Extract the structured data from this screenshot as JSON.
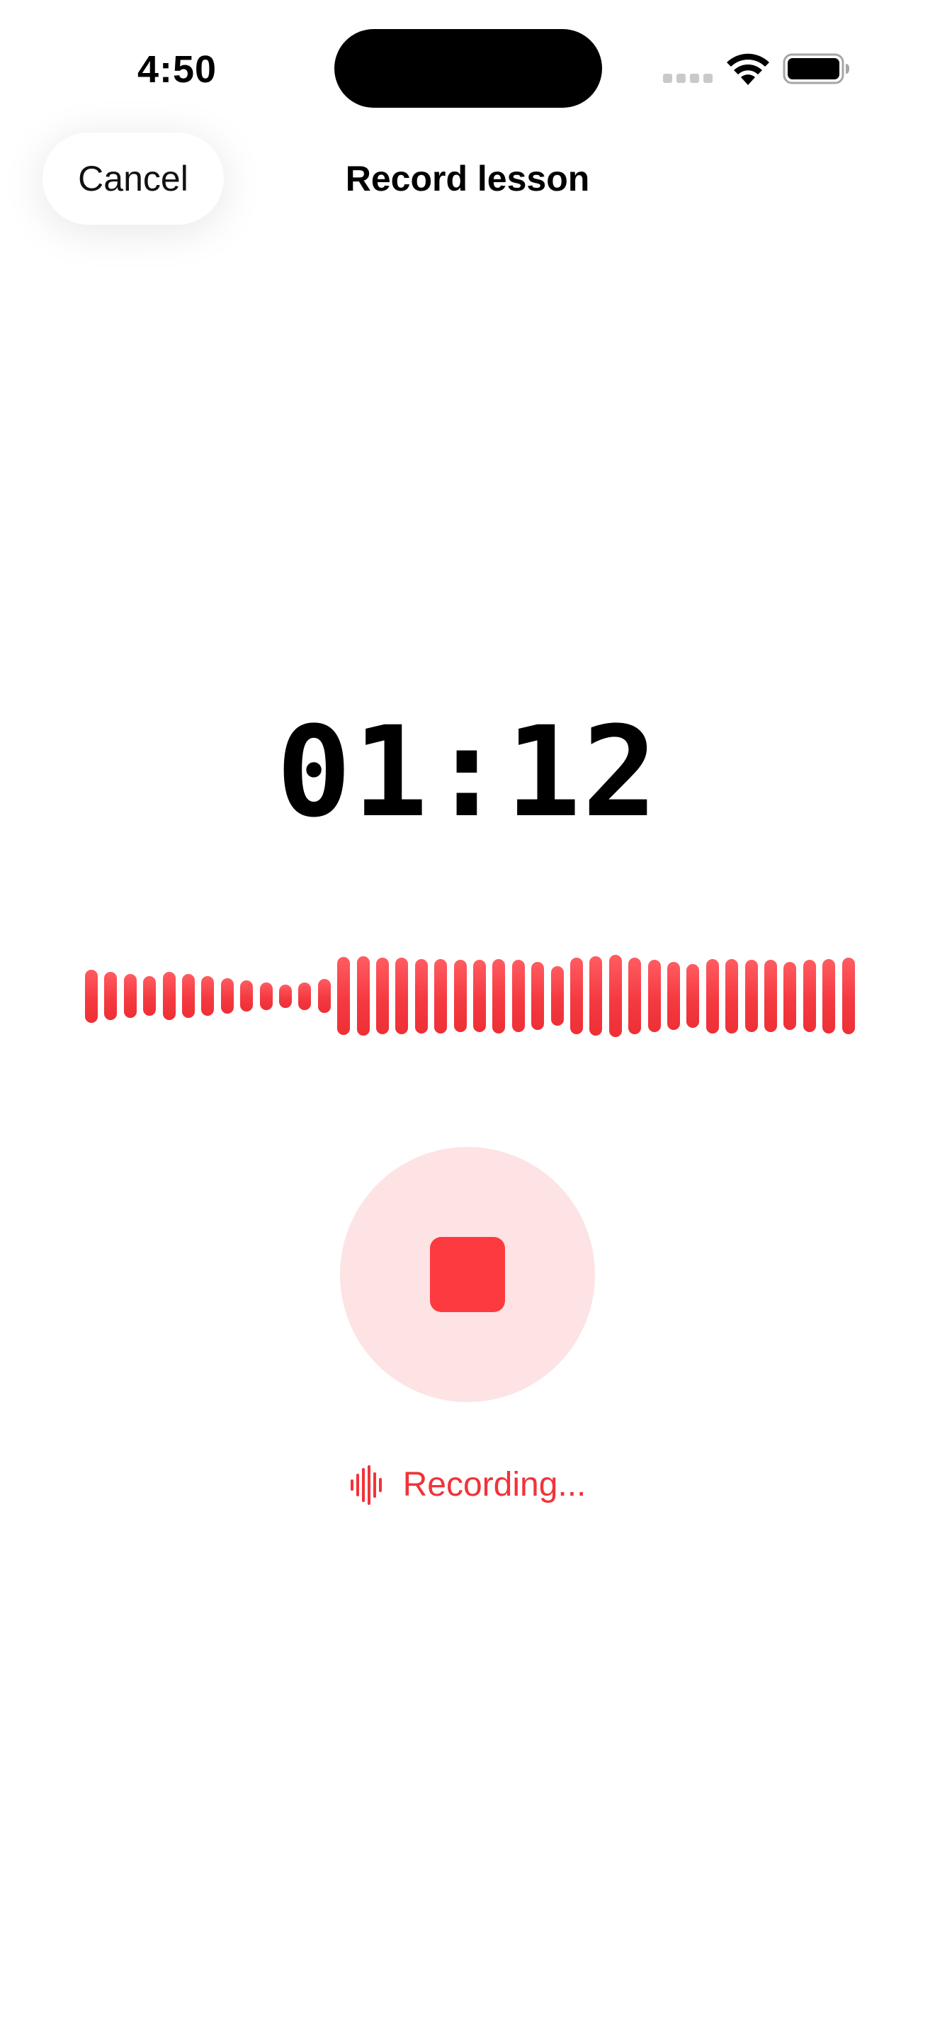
{
  "status_bar": {
    "time": "4:50"
  },
  "nav": {
    "cancel_label": "Cancel",
    "title": "Record lesson"
  },
  "recorder": {
    "elapsed": "01:12",
    "status_label": "Recording...",
    "waveform_levels": [
      0.5,
      0.45,
      0.41,
      0.37,
      0.45,
      0.41,
      0.37,
      0.33,
      0.29,
      0.26,
      0.22,
      0.26,
      0.32,
      0.73,
      0.75,
      0.72,
      0.72,
      0.7,
      0.7,
      0.68,
      0.68,
      0.7,
      0.68,
      0.64,
      0.56,
      0.72,
      0.75,
      0.77,
      0.72,
      0.68,
      0.64,
      0.6,
      0.7,
      0.7,
      0.68,
      0.68,
      0.64,
      0.68,
      0.7,
      0.72
    ]
  },
  "icons": {
    "wifi": "wifi-icon",
    "battery": "battery-icon",
    "stop": "stop-icon",
    "recording": "waveform-icon"
  },
  "colors": {
    "accent": "#f43a41",
    "stop_button_bg": "#fde3e4",
    "stop_icon": "#fd3a40",
    "text": "#000000"
  }
}
